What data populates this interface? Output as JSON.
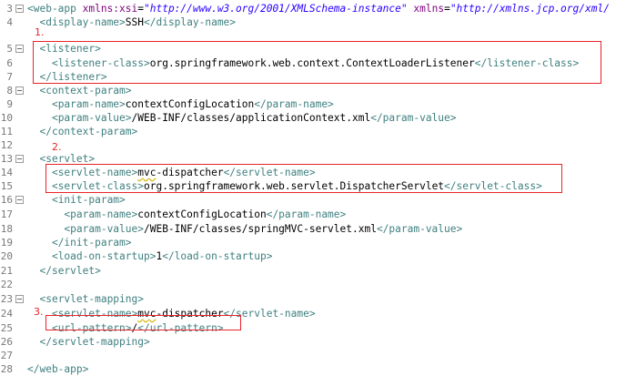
{
  "lines": [
    {
      "ln": "3",
      "fold": true,
      "indent": "",
      "tokens": [
        {
          "c": "t",
          "s": "<web-app "
        },
        {
          "c": "a",
          "s": "xmlns:xsi"
        },
        {
          "c": "x",
          "s": "="
        },
        {
          "c": "v",
          "s": "\"http://www.w3.org/2001/XMLSchema-instance\""
        },
        {
          "c": "x",
          "s": " "
        },
        {
          "c": "a",
          "s": "xmlns"
        },
        {
          "c": "x",
          "s": "="
        },
        {
          "c": "v",
          "s": "\"http://xmlns.jcp.org/xml/"
        }
      ]
    },
    {
      "ln": "4",
      "fold": false,
      "indent": "  ",
      "tokens": [
        {
          "c": "t",
          "s": "<display-name>"
        },
        {
          "c": "x",
          "s": "SSH"
        },
        {
          "c": "t",
          "s": "</display-name>"
        }
      ]
    },
    {
      "ln": "",
      "fold": false,
      "indent": "",
      "tokens": []
    },
    {
      "ln": "5",
      "fold": true,
      "indent": "  ",
      "tokens": [
        {
          "c": "t",
          "s": "<listener>"
        }
      ]
    },
    {
      "ln": "6",
      "fold": false,
      "indent": "    ",
      "tokens": [
        {
          "c": "t",
          "s": "<listener-class>"
        },
        {
          "c": "x",
          "s": "org.springframework.web.context.ContextLoaderListener"
        },
        {
          "c": "t",
          "s": "</listener-class>"
        }
      ]
    },
    {
      "ln": "7",
      "fold": false,
      "indent": "  ",
      "tokens": [
        {
          "c": "t",
          "s": "</listener>"
        }
      ]
    },
    {
      "ln": "8",
      "fold": true,
      "indent": "  ",
      "tokens": [
        {
          "c": "t",
          "s": "<context-param>"
        }
      ]
    },
    {
      "ln": "9",
      "fold": false,
      "indent": "    ",
      "tokens": [
        {
          "c": "t",
          "s": "<param-name>"
        },
        {
          "c": "x",
          "s": "contextConfigLocation"
        },
        {
          "c": "t",
          "s": "</param-name>"
        }
      ]
    },
    {
      "ln": "10",
      "fold": false,
      "indent": "    ",
      "tokens": [
        {
          "c": "t",
          "s": "<param-value>"
        },
        {
          "c": "x",
          "s": "/WEB-INF/classes/applicationContext.xml"
        },
        {
          "c": "t",
          "s": "</param-value>"
        }
      ]
    },
    {
      "ln": "11",
      "fold": false,
      "indent": "  ",
      "tokens": [
        {
          "c": "t",
          "s": "</context-param>"
        }
      ]
    },
    {
      "ln": "12",
      "fold": false,
      "indent": "",
      "tokens": []
    },
    {
      "ln": "13",
      "fold": true,
      "indent": "  ",
      "tokens": [
        {
          "c": "t",
          "s": "<servlet>"
        }
      ]
    },
    {
      "ln": "14",
      "fold": false,
      "indent": "    ",
      "tokens": [
        {
          "c": "t",
          "s": "<servlet-name>"
        },
        {
          "c": "x",
          "s": "mvc",
          "q": true
        },
        {
          "c": "x",
          "s": "-dispatcher"
        },
        {
          "c": "t",
          "s": "</servlet-name>"
        }
      ]
    },
    {
      "ln": "15",
      "fold": false,
      "indent": "    ",
      "tokens": [
        {
          "c": "t",
          "s": "<servlet-class>"
        },
        {
          "c": "x",
          "s": "org.springframework.web.servlet.DispatcherServlet"
        },
        {
          "c": "t",
          "s": "</servlet-class>"
        }
      ]
    },
    {
      "ln": "16",
      "fold": true,
      "indent": "    ",
      "tokens": [
        {
          "c": "t",
          "s": "<init-param>"
        }
      ]
    },
    {
      "ln": "17",
      "fold": false,
      "indent": "      ",
      "tokens": [
        {
          "c": "t",
          "s": "<param-name>"
        },
        {
          "c": "x",
          "s": "contextConfigLocation"
        },
        {
          "c": "t",
          "s": "</param-name>"
        }
      ]
    },
    {
      "ln": "18",
      "fold": false,
      "indent": "      ",
      "tokens": [
        {
          "c": "t",
          "s": "<param-value>"
        },
        {
          "c": "x",
          "s": "/WEB-INF/classes/springMVC-servlet.xml"
        },
        {
          "c": "t",
          "s": "</param-value>"
        }
      ]
    },
    {
      "ln": "19",
      "fold": false,
      "indent": "    ",
      "tokens": [
        {
          "c": "t",
          "s": "</init-param>"
        }
      ]
    },
    {
      "ln": "20",
      "fold": false,
      "indent": "    ",
      "tokens": [
        {
          "c": "t",
          "s": "<load-on-startup>"
        },
        {
          "c": "x",
          "s": "1"
        },
        {
          "c": "t",
          "s": "</load-on-startup>"
        }
      ]
    },
    {
      "ln": "21",
      "fold": false,
      "indent": "  ",
      "tokens": [
        {
          "c": "t",
          "s": "</servlet>"
        }
      ]
    },
    {
      "ln": "22",
      "fold": false,
      "indent": "",
      "tokens": []
    },
    {
      "ln": "23",
      "fold": true,
      "indent": "  ",
      "tokens": [
        {
          "c": "t",
          "s": "<servlet-mapping>"
        }
      ]
    },
    {
      "ln": "24",
      "fold": false,
      "indent": "    ",
      "tokens": [
        {
          "c": "t",
          "s": "<servlet-name>"
        },
        {
          "c": "x",
          "s": "mvc",
          "q": true
        },
        {
          "c": "x",
          "s": "-dispatcher"
        },
        {
          "c": "t",
          "s": "</servlet-name>"
        }
      ]
    },
    {
      "ln": "25",
      "fold": false,
      "indent": "    ",
      "tokens": [
        {
          "c": "t",
          "s": "<url-pattern>"
        },
        {
          "c": "x",
          "s": "/"
        },
        {
          "c": "t",
          "s": "</url-pattern>"
        }
      ]
    },
    {
      "ln": "26",
      "fold": false,
      "indent": "  ",
      "tokens": [
        {
          "c": "t",
          "s": "</servlet-mapping>"
        }
      ]
    },
    {
      "ln": "27",
      "fold": false,
      "indent": "",
      "tokens": []
    },
    {
      "ln": "28",
      "fold": false,
      "indent": "",
      "tokens": [
        {
          "c": "t",
          "s": "</web-app>"
        }
      ]
    }
  ],
  "annotations": [
    {
      "label": "1."
    },
    {
      "label": "2."
    },
    {
      "label": "3."
    }
  ],
  "colors": {
    "tag": "#3f7f7f",
    "attribute": "#7f007f",
    "attribute_value": "#2a00ff",
    "text": "#000000",
    "line_number": "#787878",
    "highlight_box": "#e8232a"
  }
}
